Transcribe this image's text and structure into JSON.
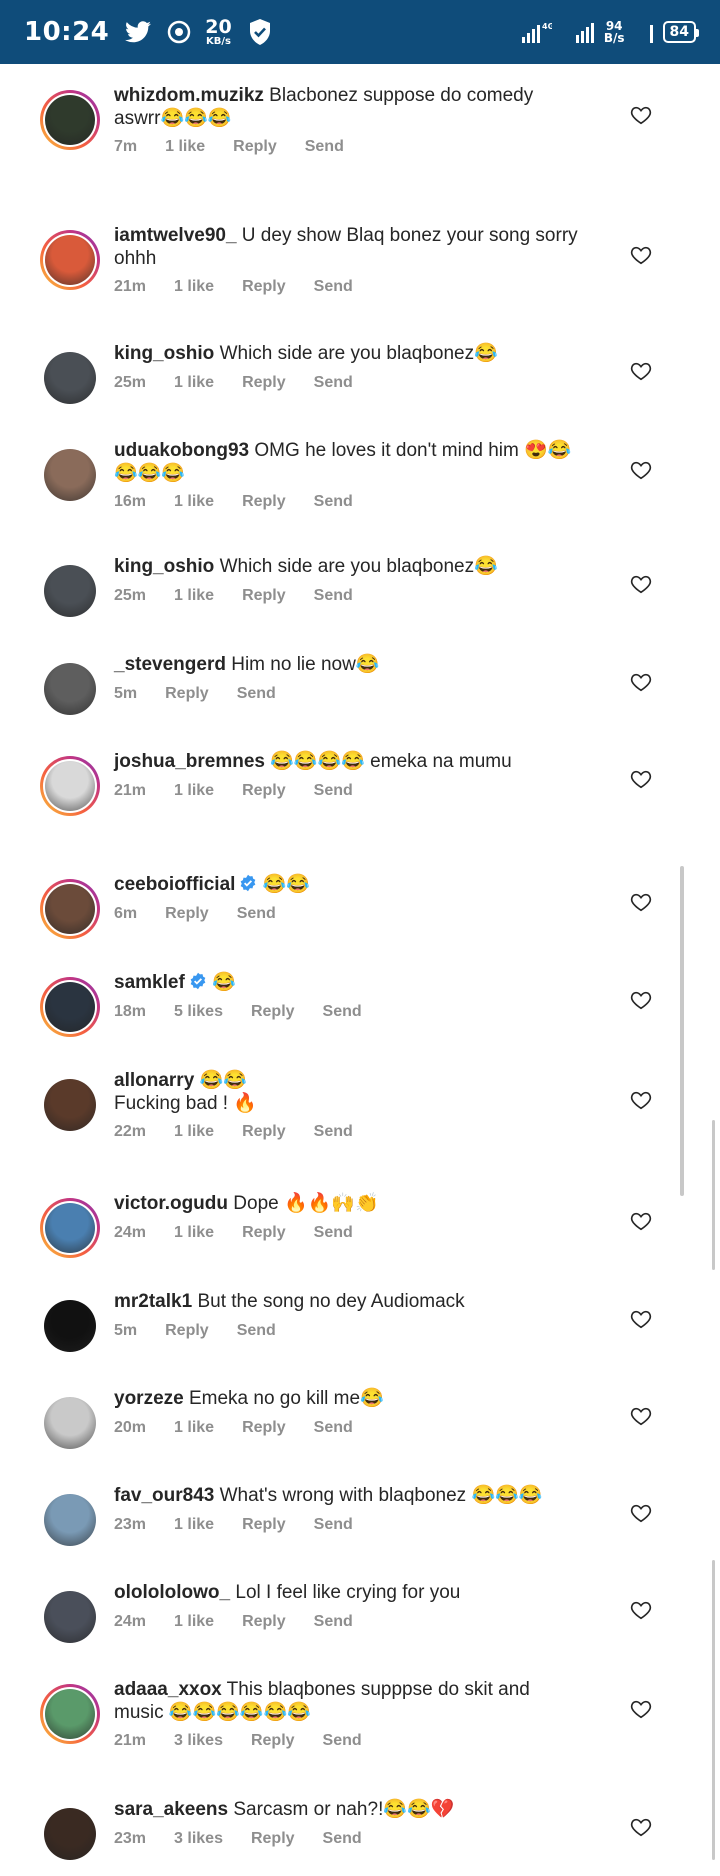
{
  "status_bar": {
    "time": "10:24",
    "speed_value": "20",
    "speed_unit": "KB/s",
    "net_value": "94",
    "net_unit": "B/s",
    "network": "4G",
    "battery": "84"
  },
  "comments": [
    {
      "username": "whizdom.muzikz",
      "text": "Blacbonez suppose do comedy aswrr😂😂😂",
      "time": "7m",
      "likes": "1 like",
      "reply": "Reply",
      "send": "Send",
      "verified": false,
      "ring": true,
      "avatar_color": "#2f3a2c"
    },
    {
      "username": "iamtwelve90_",
      "text": "U dey show Blaq bonez your song sorry ohhh",
      "time": "21m",
      "likes": "1 like",
      "reply": "Reply",
      "send": "Send",
      "verified": false,
      "ring": true,
      "avatar_color": "#d95a3a"
    },
    {
      "username": "king_oshio",
      "text": "Which side are you blaqbonez😂",
      "time": "25m",
      "likes": "1 like",
      "reply": "Reply",
      "send": "Send",
      "verified": false,
      "ring": false,
      "avatar_color": "#4a4f55"
    },
    {
      "username": "uduakobong93",
      "text": "OMG he loves it don't mind him 😍😂😂😂😂",
      "time": "16m",
      "likes": "1 like",
      "reply": "Reply",
      "send": "Send",
      "verified": false,
      "ring": false,
      "avatar_color": "#8a6b5a"
    },
    {
      "username": "king_oshio",
      "text": "Which side are you blaqbonez😂",
      "time": "25m",
      "likes": "1 like",
      "reply": "Reply",
      "send": "Send",
      "verified": false,
      "ring": false,
      "avatar_color": "#4a4f55"
    },
    {
      "username": "_stevengerd",
      "text": "Him no lie now😂",
      "time": "5m",
      "likes": "",
      "reply": "Reply",
      "send": "Send",
      "verified": false,
      "ring": false,
      "avatar_color": "#5e5e5e"
    },
    {
      "username": "joshua_bremnes",
      "text": "😂😂😂😂 emeka na mumu",
      "time": "21m",
      "likes": "1 like",
      "reply": "Reply",
      "send": "Send",
      "verified": false,
      "ring": true,
      "avatar_color": "#d9d9d9"
    },
    {
      "username": "ceeboiofficial",
      "text": "😂😂",
      "time": "6m",
      "likes": "",
      "reply": "Reply",
      "send": "Send",
      "verified": true,
      "ring": true,
      "avatar_color": "#6b4b3a"
    },
    {
      "username": "samklef",
      "text": "😂",
      "time": "18m",
      "likes": "5 likes",
      "reply": "Reply",
      "send": "Send",
      "verified": true,
      "ring": true,
      "avatar_color": "#2a3440"
    },
    {
      "username": "allonarry",
      "text": "😂😂\nFucking bad ! 🔥",
      "time": "22m",
      "likes": "1 like",
      "reply": "Reply",
      "send": "Send",
      "verified": false,
      "ring": false,
      "avatar_color": "#5a3a2a"
    },
    {
      "username": "victor.ogudu",
      "text": "Dope 🔥🔥🙌👏",
      "time": "24m",
      "likes": "1 like",
      "reply": "Reply",
      "send": "Send",
      "verified": false,
      "ring": true,
      "avatar_color": "#4a7fb0"
    },
    {
      "username": "mr2talk1",
      "text": "But the song no dey Audiomack",
      "time": "5m",
      "likes": "",
      "reply": "Reply",
      "send": "Send",
      "verified": false,
      "ring": false,
      "avatar_color": "#111111"
    },
    {
      "username": "yorzeze",
      "text": "Emeka no go kill me😂",
      "time": "20m",
      "likes": "1 like",
      "reply": "Reply",
      "send": "Send",
      "verified": false,
      "ring": false,
      "avatar_color": "#c9c9c9"
    },
    {
      "username": "fav_our843",
      "text": "What's wrong with blaqbonez 😂😂😂",
      "time": "23m",
      "likes": "1 like",
      "reply": "Reply",
      "send": "Send",
      "verified": false,
      "ring": false,
      "avatar_color": "#7a9ab5"
    },
    {
      "username": "ololololowo_",
      "text": "Lol I feel like crying for you",
      "time": "24m",
      "likes": "1 like",
      "reply": "Reply",
      "send": "Send",
      "verified": false,
      "ring": false,
      "avatar_color": "#4a4f5a"
    },
    {
      "username": "adaaa_xxox",
      "text": "This blaqbones supppse do skit and music 😂😂😂😂😂😂",
      "time": "21m",
      "likes": "3 likes",
      "reply": "Reply",
      "send": "Send",
      "verified": false,
      "ring": true,
      "avatar_color": "#5a9a6a"
    },
    {
      "username": "sara_akeens",
      "text": "Sarcasm or nah?!😂😂💔",
      "time": "23m",
      "likes": "3 likes",
      "reply": "Reply",
      "send": "Send",
      "verified": false,
      "ring": false,
      "avatar_color": "#3a2a22"
    }
  ]
}
